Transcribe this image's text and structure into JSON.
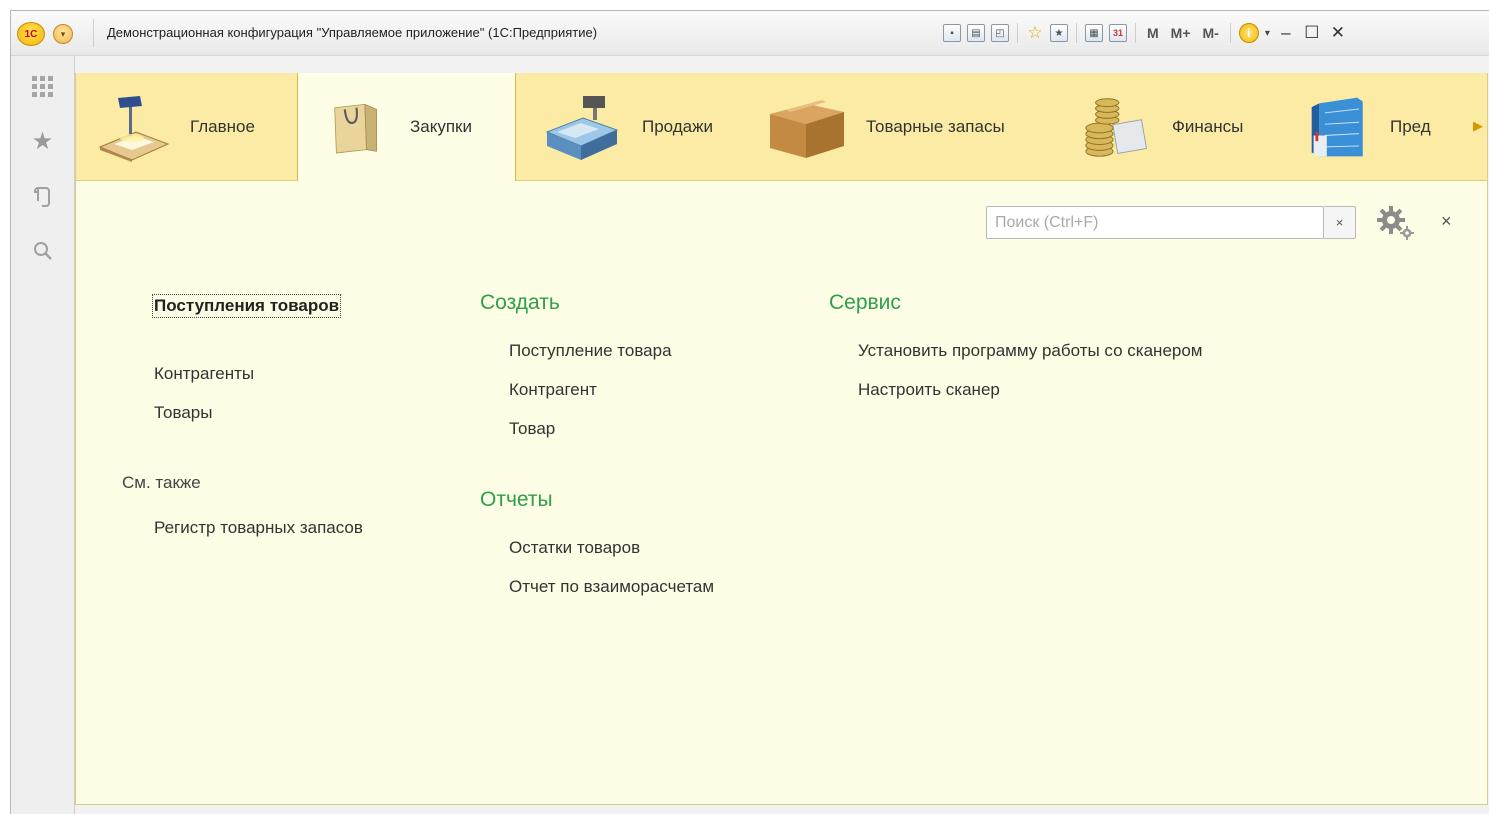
{
  "window": {
    "title": "Демонстрационная конфигурация \"Управляемое приложение\"  (1С:Предприятие)",
    "logo_text": "1С",
    "toolbar_texts": {
      "m": "M",
      "m_plus": "M+",
      "m_minus": "M-"
    },
    "calendar_day": "31"
  },
  "sections": [
    {
      "label": "Главное",
      "icon": "desk-lamp-icon",
      "active": false
    },
    {
      "label": "Закупки",
      "icon": "shopping-bag-icon",
      "active": true
    },
    {
      "label": "Продажи",
      "icon": "cash-register-icon",
      "active": false
    },
    {
      "label": "Товарные запасы",
      "icon": "cardboard-box-icon",
      "active": false
    },
    {
      "label": "Финансы",
      "icon": "coins-icon",
      "active": false
    },
    {
      "label": "Пред",
      "icon": "office-building-icon",
      "active": false
    }
  ],
  "search": {
    "placeholder": "Поиск (Ctrl+F)",
    "value": "",
    "clear_label": "×"
  },
  "close_label": "×",
  "navigation": {
    "items": [
      "Поступления товаров",
      "Контрагенты",
      "Товары"
    ],
    "see_also_title": "См. также",
    "see_also_items": [
      "Регистр товарных запасов"
    ]
  },
  "create": {
    "title": "Создать",
    "items": [
      "Поступление товара",
      "Контрагент",
      "Товар"
    ]
  },
  "reports": {
    "title": "Отчеты",
    "items": [
      "Остатки товаров",
      "Отчет по взаиморасчетам"
    ]
  },
  "service": {
    "title": "Сервис",
    "items": [
      "Установить программу работы со сканером",
      "Настроить сканер"
    ]
  },
  "colors": {
    "section_bar": "#fbeba5",
    "content_bg": "#fefde6",
    "group_title": "#2e9f4c"
  }
}
